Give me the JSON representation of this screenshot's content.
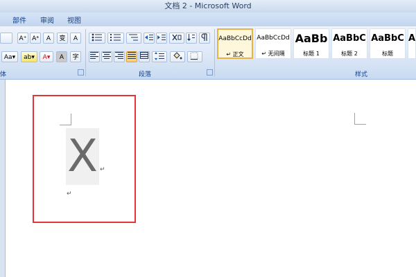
{
  "window": {
    "title": "文档 2 - Microsoft Word"
  },
  "tabs": [
    {
      "label": "部件"
    },
    {
      "label": "审阅"
    },
    {
      "label": "视图"
    }
  ],
  "ribbon": {
    "font_group_label": "体",
    "paragraph_group_label": "段落",
    "styles_group_label": "样式",
    "font_buttons": {
      "grow_font": "A⁺",
      "shrink_font": "Aᵃ",
      "clear_format": "A",
      "phonetic": "变",
      "char_border": "A",
      "change_case": "Aa▾",
      "highlight": "ab▾",
      "font_color": "A▾",
      "char_shading": "A",
      "enclose": "字"
    },
    "styles": [
      {
        "sample": "AaBbCcDd",
        "name": "↵ 正文",
        "selected": true
      },
      {
        "sample": "AaBbCcDd",
        "name": "↵ 无间隔",
        "selected": false
      },
      {
        "sample": "AaBb",
        "name": "标题 1",
        "selected": false
      },
      {
        "sample": "AaBbC",
        "name": "标题 2",
        "selected": false
      },
      {
        "sample": "AaBbC",
        "name": "标题",
        "selected": false
      },
      {
        "sample": "A",
        "name": "",
        "selected": false
      }
    ]
  },
  "document": {
    "big_letter": "X",
    "paragraph_mark": "↵"
  },
  "colors": {
    "highlight_box": "#e0363b",
    "ribbon_text": "#15428b",
    "selected_style_border": "#e8b24a"
  }
}
